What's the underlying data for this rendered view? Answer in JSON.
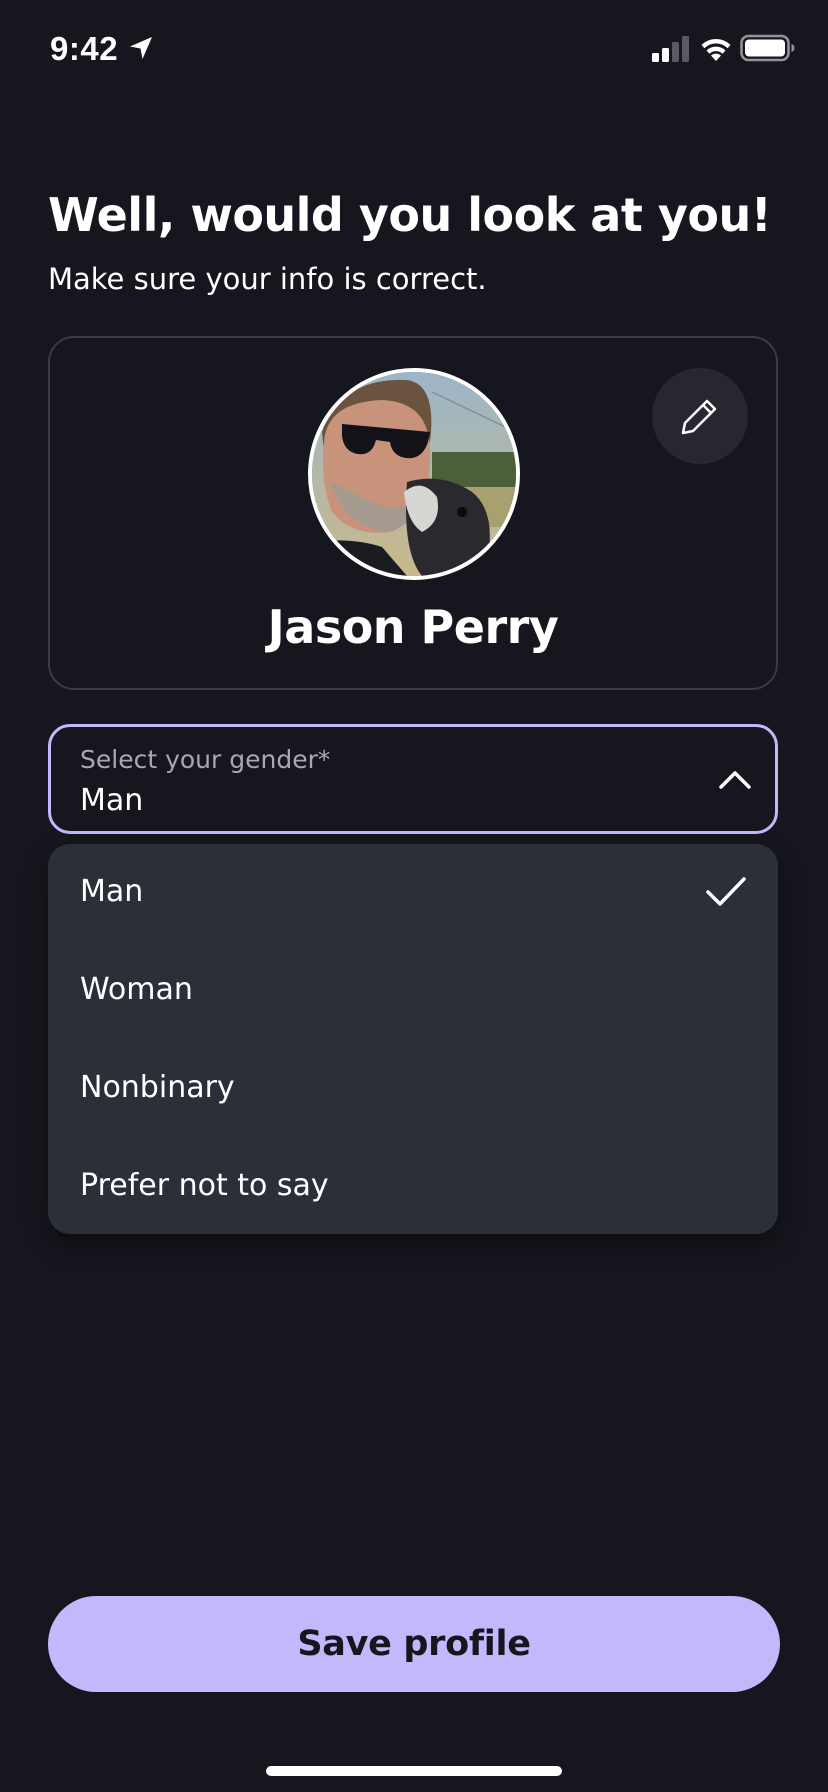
{
  "status_bar": {
    "time": "9:42",
    "icons": [
      "location-arrow-icon",
      "cellular-signal-icon",
      "wifi-icon",
      "battery-icon"
    ]
  },
  "header": {
    "title": "Well, would you look at you!",
    "subtitle": "Make sure your info is correct."
  },
  "profile": {
    "name": "Jason Perry",
    "avatar_icon": "profile-photo",
    "edit_icon": "pencil-icon"
  },
  "gender_select": {
    "label": "Select your gender*",
    "value": "Man",
    "expanded": true,
    "chevron_icon": "chevron-up-icon"
  },
  "dropdown": {
    "options": [
      {
        "label": "Man",
        "selected": true
      },
      {
        "label": "Woman",
        "selected": false
      },
      {
        "label": "Nonbinary",
        "selected": false
      },
      {
        "label": "Prefer not to say",
        "selected": false
      }
    ],
    "check_icon": "checkmark-icon"
  },
  "actions": {
    "save_label": "Save profile"
  },
  "colors": {
    "background": "#16161e",
    "accent": "#c3b8fb",
    "card_border": "#3a3b47",
    "dropdown_bg": "#2c2e38",
    "muted_text": "#a8a8b4"
  }
}
